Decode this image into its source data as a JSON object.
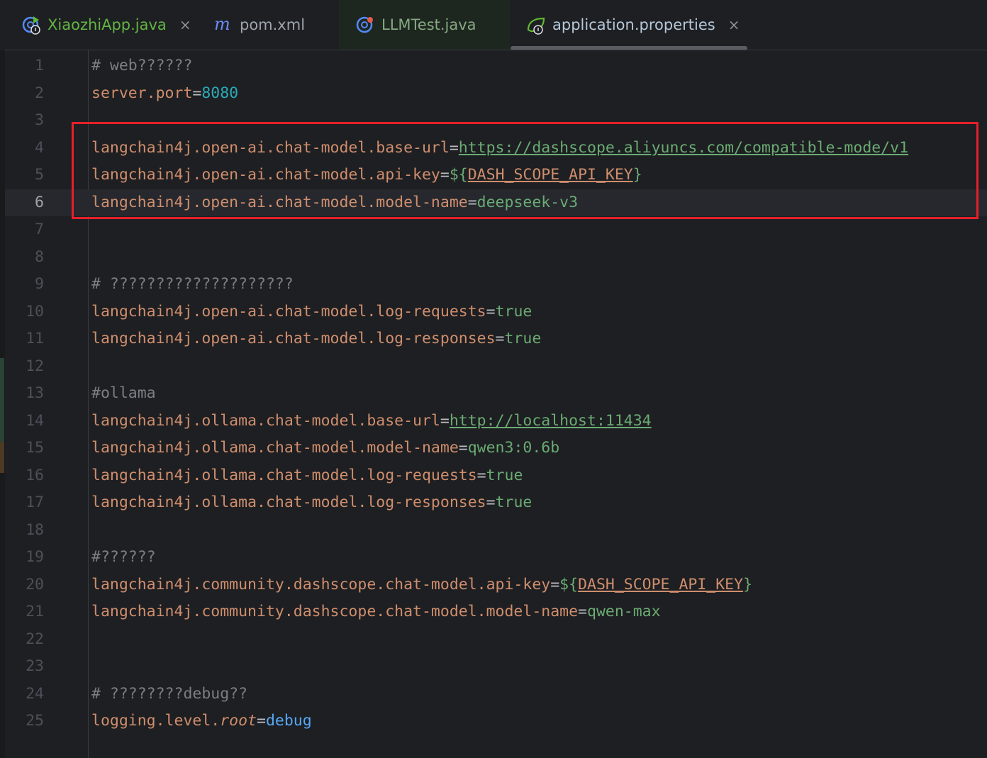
{
  "tabs": [
    {
      "label": "XiaozhiApp.java",
      "icon": "java-run-icon",
      "closable": true
    },
    {
      "label": "pom.xml",
      "icon": "maven-icon",
      "closable": false
    },
    {
      "label": "LLMTest.java",
      "icon": "java-test-icon",
      "closable": false
    },
    {
      "label": "application.properties",
      "icon": "spring-properties-icon",
      "closable": true,
      "active": true
    }
  ],
  "close_glyph": "×",
  "editor": {
    "current_line": 6,
    "lines": [
      {
        "n": "1",
        "comment": "# web??????"
      },
      {
        "n": "2",
        "key": "server.port",
        "eq": "=",
        "value": "8080"
      },
      {
        "n": "3"
      },
      {
        "n": "4",
        "key": "langchain4j.open-ai.chat-model.base-url",
        "eq": "=",
        "value": "https://dashscope.aliyuncs.com/compatible-mode/v1"
      },
      {
        "n": "5",
        "key": "langchain4j.open-ai.chat-model.api-key",
        "eq": "=",
        "brace_open": "${",
        "value": "DASH_SCOPE_API_KEY",
        "brace_close": "}"
      },
      {
        "n": "6",
        "key": "langchain4j.open-ai.chat-model.model-name",
        "eq": "=",
        "value": "deepseek-v3"
      },
      {
        "n": "7"
      },
      {
        "n": "8"
      },
      {
        "n": "9",
        "comment": "# ????????????????????"
      },
      {
        "n": "10",
        "key": "langchain4j.open-ai.chat-model.log-requests",
        "eq": "=",
        "value": "true"
      },
      {
        "n": "11",
        "key": "langchain4j.open-ai.chat-model.log-responses",
        "eq": "=",
        "value": "true"
      },
      {
        "n": "12"
      },
      {
        "n": "13",
        "comment": "#ollama"
      },
      {
        "n": "14",
        "key": "langchain4j.ollama.chat-model.base-url",
        "eq": "=",
        "value": "http://localhost:11434"
      },
      {
        "n": "15",
        "key": "langchain4j.ollama.chat-model.model-name",
        "eq": "=",
        "value": "qwen3:0.6b"
      },
      {
        "n": "16",
        "key": "langchain4j.ollama.chat-model.log-requests",
        "eq": "=",
        "value": "true"
      },
      {
        "n": "17",
        "key": "langchain4j.ollama.chat-model.log-responses",
        "eq": "=",
        "value": "true"
      },
      {
        "n": "18"
      },
      {
        "n": "19",
        "comment": "#??????"
      },
      {
        "n": "20",
        "key": "langchain4j.community.dashscope.chat-model.api-key",
        "eq": "=",
        "brace_open": "${",
        "value": "DASH_SCOPE_API_KEY",
        "brace_close": "}"
      },
      {
        "n": "21",
        "key": "langchain4j.community.dashscope.chat-model.model-name",
        "eq": "=",
        "value": "qwen-max"
      },
      {
        "n": "22"
      },
      {
        "n": "23"
      },
      {
        "n": "24",
        "comment": "# ????????debug??"
      },
      {
        "n": "25",
        "key_prefix": "logging.level.",
        "key_italic": "root",
        "eq": "=",
        "value": "debug"
      }
    ]
  },
  "colors": {
    "background": "#1e1f22",
    "highlight_box": "#e5202a",
    "key": "#cf8e6d",
    "string_value": "#6aab73",
    "number_value": "#2aacb8",
    "comment": "#7a7e85"
  }
}
